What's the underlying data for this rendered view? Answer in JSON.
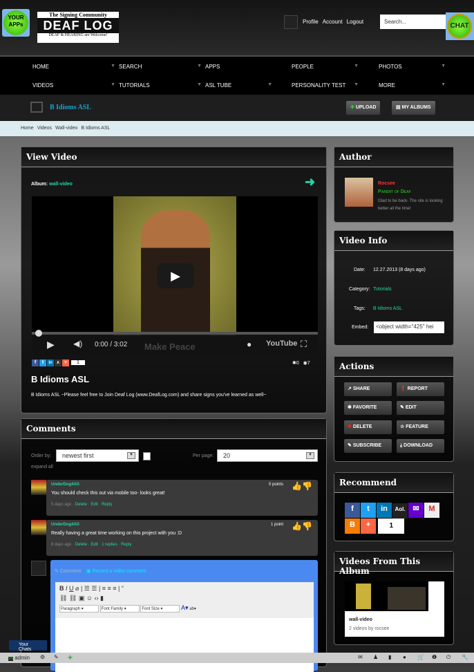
{
  "header": {
    "your_apps": "YOUR APPs",
    "logo_top": "The Signing Community",
    "logo_main": "DEAF LOG",
    "logo_bottom": "DEAF & HEARING are Welcome!",
    "links": [
      "Profile",
      "Account",
      "Logout"
    ],
    "search_placeholder": "Search...",
    "chat": "CHAT"
  },
  "nav": [
    [
      "HOME",
      "SEARCH",
      "APPS",
      "PEOPLE",
      "PHOTOS"
    ],
    [
      "VIDEOS",
      "TUTORIALS",
      "ASL TUBE",
      "PERSONALITY TEST",
      "MORE"
    ]
  ],
  "titlebar": {
    "title": "B Idioms ASL",
    "upload": "UPLOAD",
    "my_albums": "MY ALBUMS"
  },
  "breadcrumb": [
    "Home",
    "Videos",
    "Wall-video",
    "B Idioms ASL"
  ],
  "view_video": {
    "heading": "View Video",
    "album_label": "Album:",
    "album": "wall-video",
    "time": "0:00 / 3:02",
    "share_count": "1",
    "likes": "0",
    "views": "7",
    "title": "B Idioms ASL",
    "description": "B Idioms ASL ~Please feel free to Join Deaf Log (www.DeafLog.com) and share signs you've learned as well~",
    "overlay_text": "Make Peace"
  },
  "author": {
    "heading": "Author",
    "name": "Rocsee",
    "role": "Parent of Deaf",
    "status": "Glad to be back- The site is looking better all the time!"
  },
  "video_info": {
    "heading": "Video Info",
    "date_label": "Date:",
    "date": "12.27.2013 (8 days ago)",
    "category_label": "Category:",
    "category": "Tutorials",
    "tags_label": "Tags:",
    "tags": "B Idioms ASL",
    "embed_label": "Embed:",
    "embed": "<object width=\"425\" hei"
  },
  "actions": {
    "heading": "Actions",
    "buttons": [
      "SHARE",
      "REPORT",
      "FAVORITE",
      "EDIT",
      "DELETE",
      "FEATURE",
      "SUBSCRIBE",
      "DOWNLOAD"
    ]
  },
  "recommend": {
    "heading": "Recommend",
    "count": "1"
  },
  "album_videos": {
    "heading": "Videos From This Album",
    "name": "wall-video",
    "meta": "2 videos by rocsee"
  },
  "comments": {
    "heading": "Comments",
    "order_label": "Order by:",
    "order_value": "newest first",
    "per_page_label": "Per page:",
    "per_page_value": "20",
    "expand": "expand all",
    "items": [
      {
        "user": "UnderDog4All:",
        "points": "0 points",
        "text": "You should check this out via mobile too- looks great!",
        "ago": "5 days ago",
        "links": [
          "Delete",
          "Edit",
          "Reply"
        ]
      },
      {
        "user": "UnderDog4All:",
        "points": "1 point",
        "text": "Really having a great time working on this project with you :D",
        "ago": "8 days ago",
        "links": [
          "Delete",
          "Edit",
          "1 replies",
          "Reply"
        ]
      }
    ],
    "tab_comment": "Comment",
    "tab_video": "Record a video comment",
    "fmt_paragraph": "Paragraph",
    "fmt_family": "Font Family",
    "fmt_size": "Font Size"
  },
  "bottom": {
    "your_chats": "Your Chats",
    "user": "admin"
  }
}
